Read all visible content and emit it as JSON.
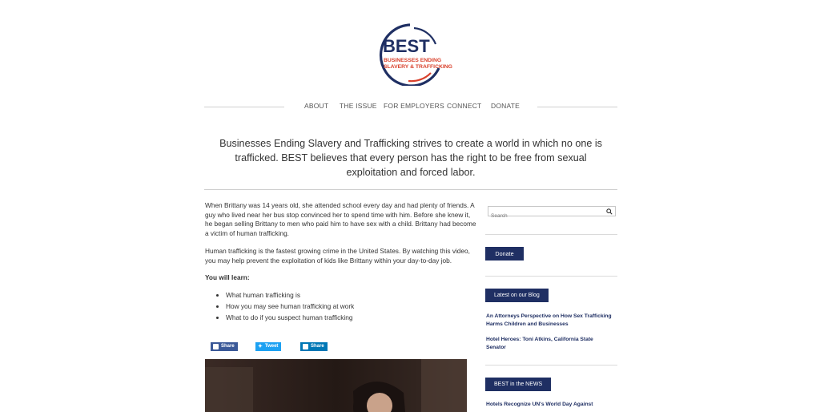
{
  "logo": {
    "wordmark": "BEST",
    "line1": "BUSINESSES ENDING",
    "line2": "SLAVERY & TRAFFICKING",
    "colors": {
      "navy": "#1f2f63",
      "red": "#d9402b"
    }
  },
  "nav": {
    "items": [
      "ABOUT",
      "THE ISSUE",
      "FOR EMPLOYERS",
      "CONNECT",
      "DONATE"
    ]
  },
  "mission": {
    "text": "Businesses Ending Slavery and Trafficking strives to create a world in which no one is trafficked. BEST believes that every person has the right to be free from sexual exploitation and forced labor."
  },
  "article": {
    "para1": "When Brittany was 14 years old, she attended school every day and had plenty of friends. A guy who lived near her bus stop convinced her to spend time with him. Before she knew it, he began selling Brittany to men who paid him to have sex with a child. Brittany had become a victim of human trafficking.",
    "para2": "Human trafficking is the fastest growing crime in the United States. By watching this video, you may help prevent the exploitation of kids like Brittany within your day-to-day job.",
    "learn_title": "You will learn:",
    "learn_items": [
      "What human trafficking is",
      "How you may see human trafficking at work",
      "What to do if you suspect human trafficking"
    ]
  },
  "share": {
    "facebook": "Share",
    "twitter": "Tweet",
    "linkedin": "Share",
    "colors": {
      "facebook": "#3b5998",
      "twitter": "#1da1f2",
      "linkedin": "#0077b5"
    }
  },
  "sidebar": {
    "search_placeholder": "Search",
    "donate_label": "Donate",
    "blog_heading": "Latest on our Blog",
    "blog_links": [
      "An Attorneys Perspective on How Sex Trafficking Harms Children and Businesses",
      "Hotel Heroes: Toni Atkins, California State Senator"
    ],
    "news_heading": "BEST in the NEWS",
    "news_links": [
      "Hotels Recognize UN's World Day Against"
    ]
  }
}
